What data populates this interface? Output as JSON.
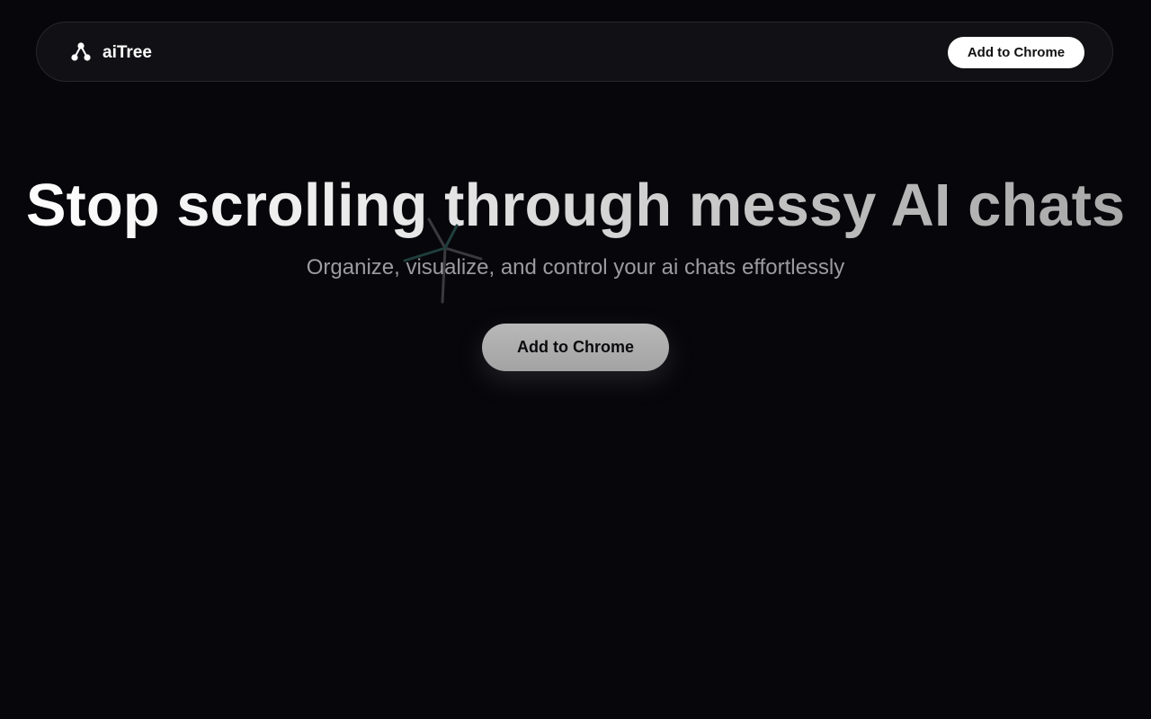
{
  "header": {
    "brand_name": "aiTree",
    "brand_icon": "tree-nodes-icon",
    "cta_label": "Add to Chrome"
  },
  "hero": {
    "title": "Stop scrolling through messy AI chats",
    "subtitle": "Organize, visualize, and control your ai chats effortlessly",
    "cta_label": "Add to Chrome",
    "decoration_icon": "spark-burst-icon"
  },
  "colors": {
    "background": "#07060b",
    "nav_background": "#111115",
    "nav_cta_background": "#ffffff",
    "hero_cta_background": "#b0b0b0",
    "subtitle_text": "#9b9ba1",
    "spark_accent": "#1f3e3c"
  }
}
